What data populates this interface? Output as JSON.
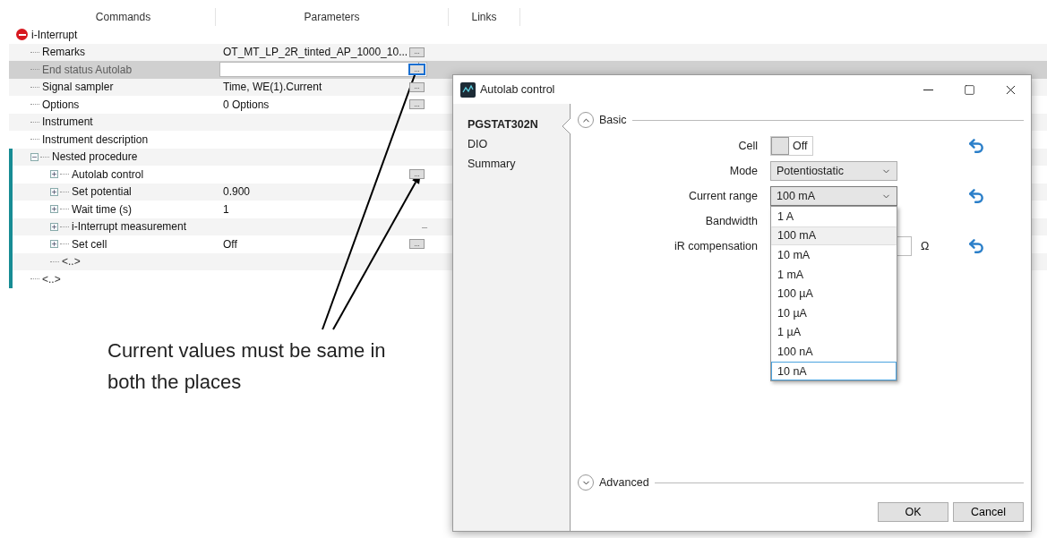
{
  "tree": {
    "columns": [
      "Commands",
      "Parameters",
      "Links"
    ],
    "nodes": [
      {
        "label": "i-Interrupt",
        "kind": "command",
        "selected": false,
        "children": [
          {
            "label": "Remarks",
            "kind": "param",
            "value": "OT_MT_LP_2R_tinted_AP_1000_10...",
            "button": "...",
            "selected": false
          },
          {
            "label": "End status Autolab",
            "kind": "param",
            "button": "...",
            "selected": true
          },
          {
            "label": "Signal sampler",
            "kind": "param",
            "value": "Time, WE(1).Current",
            "button": "...",
            "selected": false
          },
          {
            "label": "Options",
            "kind": "param",
            "value": "0 Options",
            "button": "...",
            "selected": false
          },
          {
            "label": "Instrument",
            "kind": "param",
            "selected": false
          },
          {
            "label": "Instrument description",
            "kind": "param",
            "selected": false
          },
          {
            "label": "Nested procedure",
            "kind": "group",
            "expanded": true,
            "selected": false,
            "children": [
              {
                "label": "Autolab control",
                "kind": "command",
                "expanded": false,
                "button": "...",
                "selected": false
              },
              {
                "label": "Set potential",
                "kind": "command",
                "expanded": false,
                "value": "0.900",
                "selected": false
              },
              {
                "label": "Wait time (s)",
                "kind": "command",
                "expanded": false,
                "value": "1",
                "selected": false
              },
              {
                "label": "i-Interrupt measurement",
                "kind": "command",
                "expanded": false,
                "marker": "–",
                "selected": false
              },
              {
                "label": "Set cell",
                "kind": "command",
                "expanded": false,
                "value": "Off",
                "button": "...",
                "selected": false
              },
              {
                "label": "<..>",
                "kind": "placeholder",
                "selected": false
              }
            ]
          },
          {
            "label": "<..>",
            "kind": "placeholder",
            "selected": false
          }
        ]
      }
    ]
  },
  "dialog": {
    "title": "Autolab control",
    "nav": [
      {
        "label": "PGSTAT302N",
        "selected": true
      },
      {
        "label": "DIO",
        "selected": false
      },
      {
        "label": "Summary",
        "selected": false
      }
    ],
    "basic": {
      "title": "Basic",
      "expanded": true,
      "fields": [
        {
          "kind": "toggle",
          "label": "Cell",
          "on": false,
          "value": "Off",
          "reset": true
        },
        {
          "kind": "select",
          "label": "Mode",
          "value": "Potentiostatic",
          "reset": false
        },
        {
          "kind": "select",
          "label": "Current range",
          "value": "100 mA",
          "reset": true,
          "open": true,
          "options": [
            {
              "label": "1 A",
              "selected": false,
              "focused": false
            },
            {
              "label": "100 mA",
              "selected": true,
              "focused": false
            },
            {
              "label": "10 mA",
              "selected": false,
              "focused": false
            },
            {
              "label": "1 mA",
              "selected": false,
              "focused": false
            },
            {
              "label": "100 µA",
              "selected": false,
              "focused": false
            },
            {
              "label": "10 µA",
              "selected": false,
              "focused": false
            },
            {
              "label": "1 µA",
              "selected": false,
              "focused": false
            },
            {
              "label": "100 nA",
              "selected": false,
              "focused": false
            },
            {
              "label": "10 nA",
              "selected": false,
              "focused": true
            }
          ]
        },
        {
          "kind": "covered",
          "label": "Bandwidth",
          "reset": false
        },
        {
          "kind": "number",
          "label": "iR compensation",
          "unit": "Ω",
          "reset": true
        }
      ]
    },
    "advanced": {
      "title": "Advanced",
      "expanded": false
    },
    "buttons": [
      "OK",
      "Cancel"
    ]
  },
  "annotation": {
    "text": "Current values must be same in both the places"
  }
}
